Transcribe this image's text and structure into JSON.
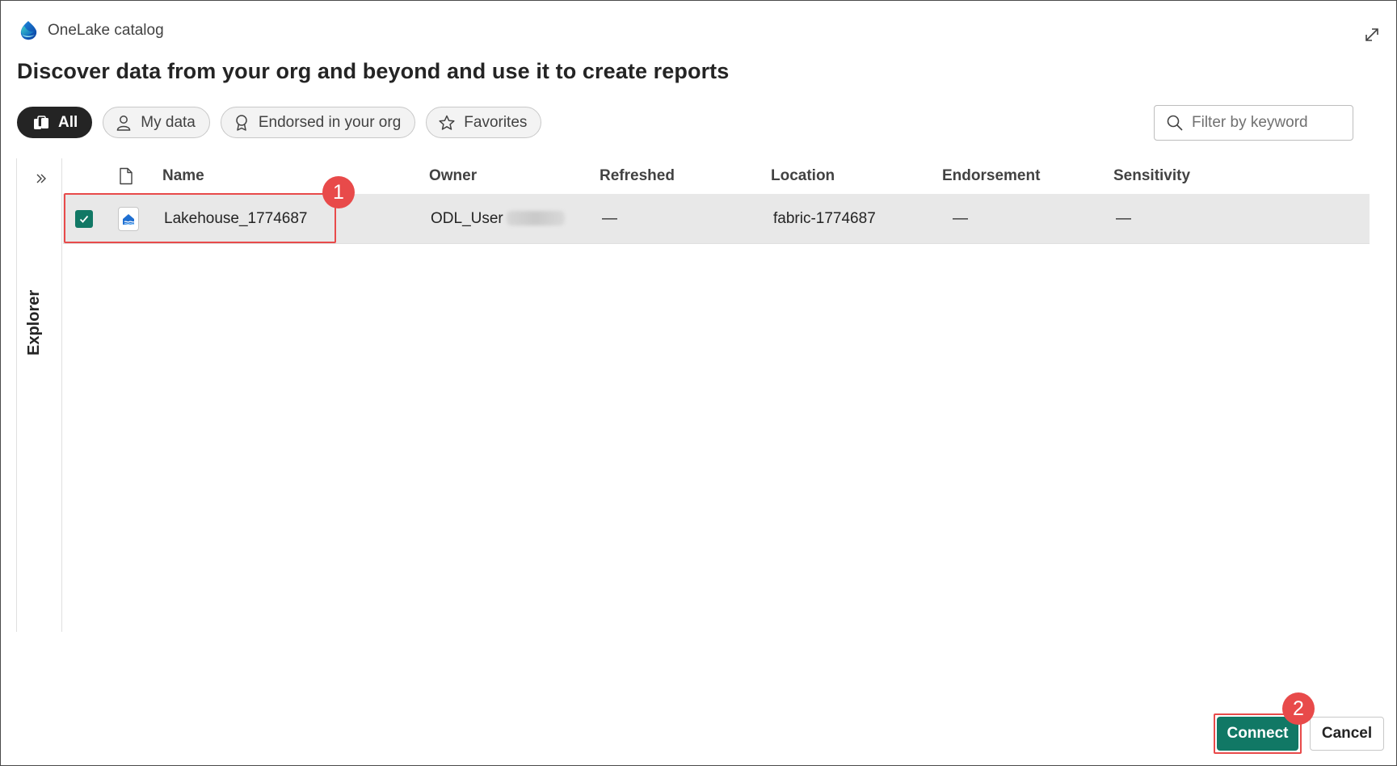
{
  "dialog": {
    "title": "OneLake catalog",
    "headline": "Discover data from your org and beyond and use it to create reports"
  },
  "filters": [
    {
      "label": "All",
      "icon": "stack-icon",
      "active": true
    },
    {
      "label": "My data",
      "icon": "person-icon",
      "active": false
    },
    {
      "label": "Endorsed in your org",
      "icon": "ribbon-icon",
      "active": false
    },
    {
      "label": "Favorites",
      "icon": "star-icon",
      "active": false
    }
  ],
  "search": {
    "placeholder": "Filter by keyword",
    "value": ""
  },
  "explorer": {
    "label": "Explorer"
  },
  "table": {
    "columns": {
      "name": "Name",
      "owner": "Owner",
      "refreshed": "Refreshed",
      "location": "Location",
      "endorsement": "Endorsement",
      "sensitivity": "Sensitivity"
    },
    "rows": [
      {
        "selected": true,
        "icon": "lakehouse-icon",
        "name": "Lakehouse_1774687",
        "owner": "ODL_User",
        "refreshed": "—",
        "location": "fabric-1774687",
        "endorsement": "—",
        "sensitivity": "—"
      }
    ]
  },
  "annotations": {
    "step1": "1",
    "step2": "2",
    "color": "#e84a4a"
  },
  "footer": {
    "connect_label": "Connect",
    "cancel_label": "Cancel"
  },
  "colors": {
    "primary": "#117865",
    "active_pill": "#242424",
    "selected_row": "#e8e8e8"
  }
}
